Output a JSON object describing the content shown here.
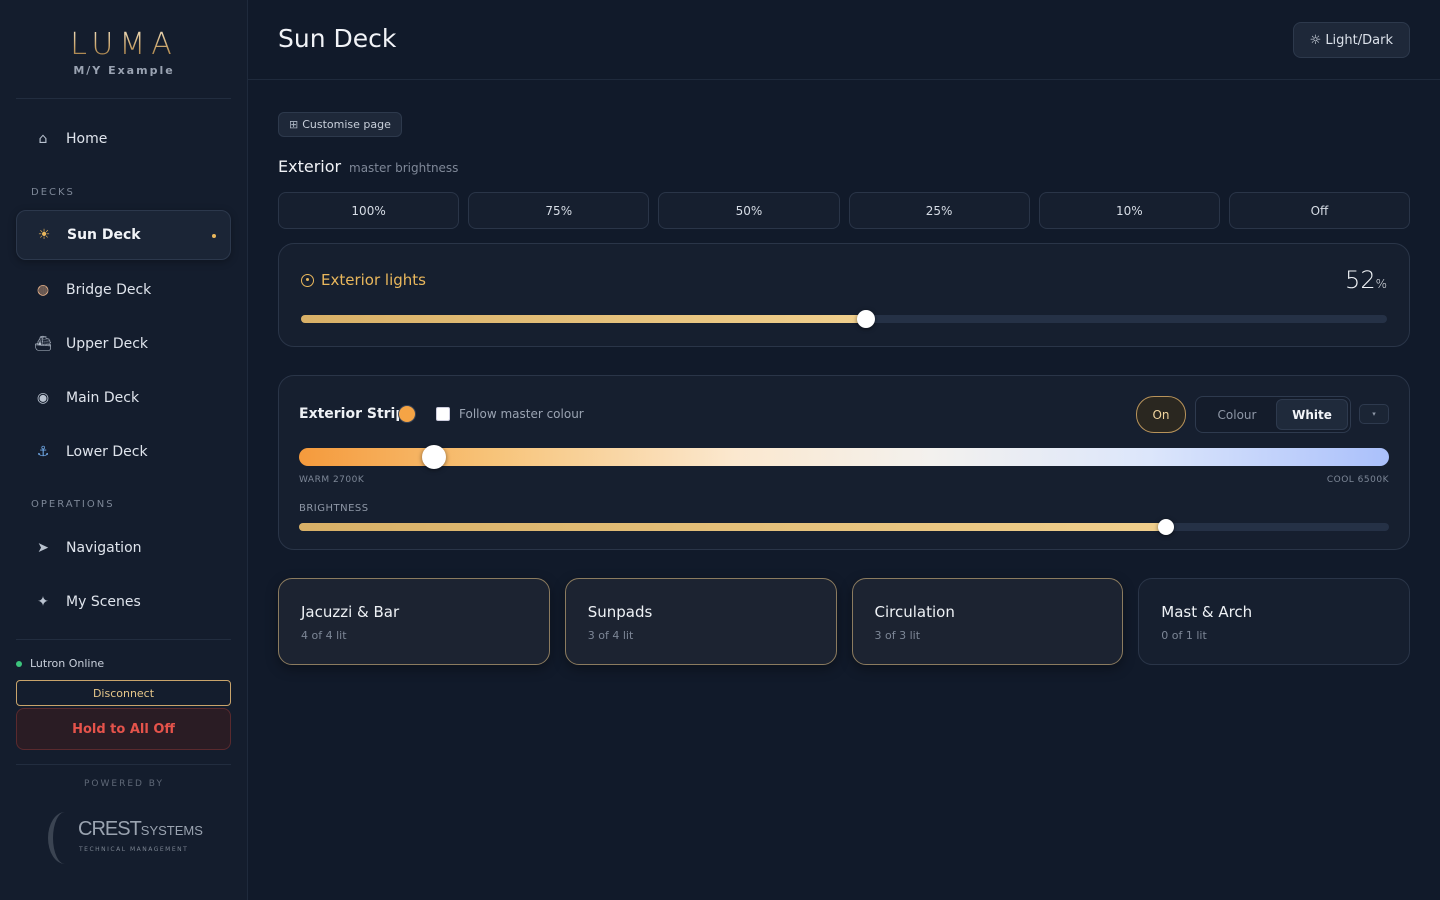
{
  "brand": {
    "logo": "LUMA",
    "vessel": "M/Y Example"
  },
  "sidebar": {
    "home_label": "Home",
    "decks_label": "DECKS",
    "decks": [
      {
        "label": "Sun Deck",
        "icon": "sun-icon",
        "active": true
      },
      {
        "label": "Bridge Deck",
        "icon": "compass-icon",
        "active": false
      },
      {
        "label": "Upper Deck",
        "icon": "boat-icon",
        "active": false
      },
      {
        "label": "Main Deck",
        "icon": "dining-icon",
        "active": false
      },
      {
        "label": "Lower Deck",
        "icon": "anchor-icon",
        "active": false
      }
    ],
    "operations_label": "OPERATIONS",
    "operations": [
      {
        "label": "Navigation",
        "icon": "navigation-arrow-icon"
      },
      {
        "label": "My Scenes",
        "icon": "sparkle-icon"
      }
    ],
    "status_text": "Lutron Online",
    "status_color": "#3cc47c",
    "disconnect_label": "Disconnect",
    "all_off_label": "Hold to All Off",
    "powered_by": "POWERED BY",
    "partner_name": "CREST",
    "partner_suffix": "SYSTEMS",
    "partner_tagline": "TECHNICAL MANAGEMENT"
  },
  "header": {
    "title": "Sun Deck",
    "theme_toggle_label": "Light/Dark"
  },
  "main": {
    "customise_label": "Customise page",
    "exterior_title": "Exterior",
    "exterior_subtitle": "master brightness",
    "presets": [
      "100%",
      "75%",
      "50%",
      "25%",
      "10%",
      "Off"
    ],
    "exterior_lights": {
      "title": "Exterior lights",
      "value": "52",
      "unit": "%",
      "level": 0.52
    },
    "strip": {
      "title": "Exterior Strip",
      "swatch_color": "#f5a445",
      "follow_label": "Follow master colour",
      "follow_checked": false,
      "on_label": "On",
      "mode_colour_label": "Colour",
      "mode_white_label": "White",
      "expand_label": "▾",
      "temperature_level": 0.124,
      "warm_label": "WARM 2700K",
      "cool_label": "COOL 6500K",
      "brightness_label": "BRIGHTNESS",
      "brightness_level": 0.795
    },
    "zones": [
      {
        "name": "Jacuzzi & Bar",
        "count": "4 of 4 lit",
        "lit": true
      },
      {
        "name": "Sunpads",
        "count": "3 of 4 lit",
        "lit": true
      },
      {
        "name": "Circulation",
        "count": "3 of 3 lit",
        "lit": true
      },
      {
        "name": "Mast & Arch",
        "count": "0 of 1 lit",
        "lit": false
      }
    ]
  },
  "colors": {
    "accent": "#e9b75c",
    "danger": "#e5534b",
    "background": "#111a2a"
  }
}
